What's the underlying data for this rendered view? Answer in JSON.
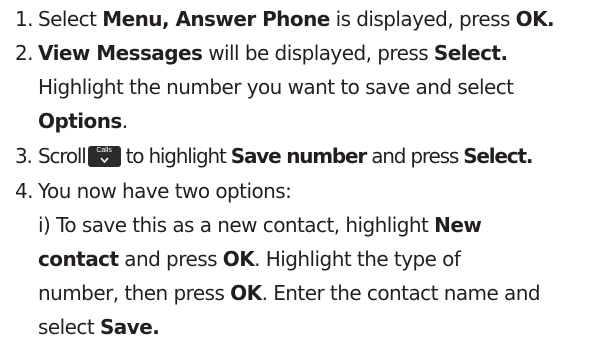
{
  "steps": [
    {
      "num": "1.",
      "lines": [
        [
          {
            "text": "Select ",
            "bold": false
          },
          {
            "text": "Menu",
            "bold": true
          },
          {
            "text": ", ",
            "bold": true
          },
          {
            "text": "Answer Phone",
            "bold": true
          },
          {
            "text": " is displayed, press ",
            "bold": false
          },
          {
            "text": "OK",
            "bold": true
          },
          {
            "text": ".",
            "bold": false
          }
        ]
      ]
    },
    {
      "num": "2.",
      "lines": [
        [
          {
            "text": "View Messages",
            "bold": true
          },
          {
            "text": " will be displayed, press ",
            "bold": false
          },
          {
            "text": "Select",
            "bold": true
          },
          {
            "text": ".",
            "bold": false
          }
        ],
        [
          {
            "text": "Highlight the number you want to save and select",
            "bold": false
          }
        ],
        [
          {
            "text": "Options",
            "bold": true
          },
          {
            "text": ".",
            "bold": false
          }
        ]
      ]
    },
    {
      "num": "3.",
      "lines": [
        [
          {
            "text": "Scroll",
            "bold": false
          },
          {
            "key": "Calls",
            "icon": "calls-scroll-down-key-icon"
          },
          {
            "text": "to highlight ",
            "bold": false
          },
          {
            "text": "Save number",
            "bold": true
          },
          {
            "text": " and press ",
            "bold": false
          },
          {
            "text": "Select",
            "bold": true
          },
          {
            "text": ".",
            "bold": false
          }
        ]
      ]
    },
    {
      "num": "4.",
      "lines": [
        [
          {
            "text": "You now have two options:",
            "bold": false
          }
        ],
        [
          {
            "text": "i) To save this as a new contact, highlight ",
            "bold": false
          },
          {
            "text": "New",
            "bold": true
          }
        ],
        [
          {
            "text": "contact",
            "bold": true
          },
          {
            "text": " and press ",
            "bold": false
          },
          {
            "text": "OK",
            "bold": true
          },
          {
            "text": ". Highlight the type of",
            "bold": false
          }
        ],
        [
          {
            "text": "number, then press ",
            "bold": false
          },
          {
            "text": "OK",
            "bold": true
          },
          {
            "text": ". Enter the contact name and",
            "bold": false
          }
        ],
        [
          {
            "text": "select ",
            "bold": false
          },
          {
            "text": "Save",
            "bold": true
          },
          {
            "text": ".",
            "bold": false
          }
        ]
      ]
    }
  ],
  "colors": {
    "text": "#231f20",
    "key_background": "#2b2b2b",
    "key_text": "#ffffff"
  }
}
